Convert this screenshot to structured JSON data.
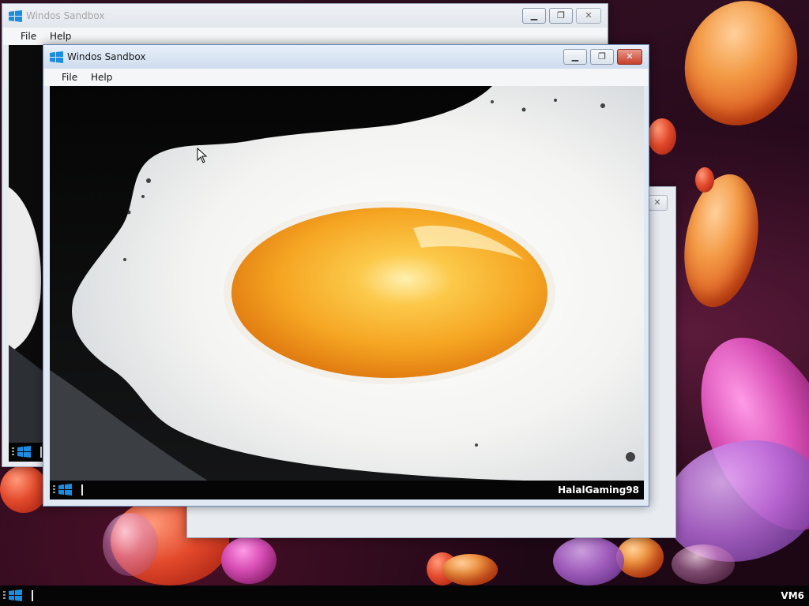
{
  "colors": {
    "windows_blue": "#1b8de0",
    "titlebar_active": "#d3dfee",
    "close_button_red": "#c7402b",
    "taskbar": "#050505",
    "yolk": "#f5a623"
  },
  "back_window": {
    "title": "Windos Sandbox",
    "menu": [
      "File",
      "Help"
    ],
    "controls": {
      "minimize_icon": "minimize-icon",
      "restore_icon": "restore-icon",
      "close_icon": "close-icon"
    }
  },
  "front_window": {
    "title": "Windos Sandbox",
    "menu": [
      "File",
      "Help"
    ],
    "controls": {
      "minimize_icon": "minimize-icon",
      "restore_icon": "restore-icon",
      "close_icon": "close-icon"
    },
    "screen": {
      "content": "fried-egg-wallpaper",
      "taskbar": {
        "start_icon": "windows-logo-icon",
        "user_label": "HalalGaming98"
      }
    }
  },
  "host_taskbar": {
    "start_icon": "windows-logo-icon",
    "machine_label": "VM6"
  },
  "glyphs": {
    "minimize": "▁",
    "restore": "❐",
    "close": "✕"
  }
}
